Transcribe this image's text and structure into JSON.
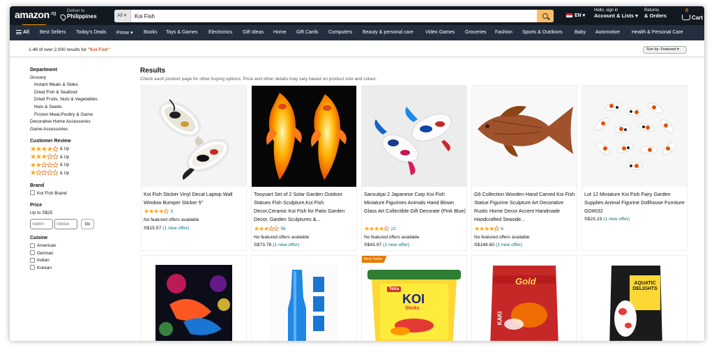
{
  "header": {
    "logo": "amazon",
    "logo_suffix": ".sg",
    "deliver_label": "Deliver to",
    "deliver_location": "Philippines",
    "search_category": "All",
    "search_value": "Koi Fish",
    "language": "EN",
    "account_hello": "Hello, sign in",
    "account_label": "Account & Lists",
    "returns_label": "Returns",
    "orders_label": "& Orders",
    "cart_count": "0",
    "cart_label": "Cart"
  },
  "nav": {
    "all_label": "All",
    "items": [
      "Best Sellers",
      "Today's Deals",
      "Prime",
      "Books",
      "Toys & Games",
      "Electronics",
      "Gift Ideas",
      "Home",
      "Gift Cards",
      "Computers",
      "Beauty & personal care",
      "Video Games",
      "Groceries",
      "Fashion",
      "Sports & Outdoors",
      "Baby",
      "Automotive",
      "Health & Personal Care"
    ]
  },
  "results_bar": {
    "count_text": "1-48 of over 2,000 results for",
    "query": "\"Koi Fish\"",
    "sort_label": "Sort by: Featured"
  },
  "sidebar": {
    "department_title": "Department",
    "department_items": [
      "Grocery",
      "Instant Meals & Sides",
      "Dried Fish & Seafood",
      "Dried Fruits, Nuts & Vegetables",
      "Nuts & Seeds",
      "Frozen Meat,Poultry & Game",
      "Decorative Home Accessories",
      "Game Accessories"
    ],
    "review_title": "Customer Review",
    "review_up": "& Up",
    "review_levels": [
      4,
      3,
      2,
      1
    ],
    "brand_title": "Brand",
    "brand_items": [
      "Koi Fish Brand"
    ],
    "price_title": "Price",
    "price_option": "Up to S$25",
    "price_min_placeholder": "S$Min",
    "price_max_placeholder": "S$Max",
    "go_label": "Go",
    "cuisine_title": "Cuisine",
    "cuisine_items": [
      "American",
      "German",
      "Indian",
      "Korean"
    ]
  },
  "main": {
    "title": "Results",
    "subtitle": "Check each product page for other buying options. Price and other details may vary based on product size and colour."
  },
  "products": [
    {
      "title": "Koi Fish Sticker Vinyl Decal Laptop Wall Window Bumper Sticker 5\"",
      "rating": 4.5,
      "reviews": "3",
      "offers": "No featured offers available",
      "price": "S$15.57",
      "new_offer": "(1 new offer)"
    },
    {
      "title": "Tooyuart Set of 2 Solar Garden Outdoor Statues Fish Sculpture,Koi Fish Decor,Ceramic Koi Fish for Patio Garden Decor, Garden Sculptures &...",
      "rating": 3.5,
      "reviews": "56",
      "offers": "No featured offers available",
      "price": "S$73.78",
      "new_offer": "(1 new offer)"
    },
    {
      "title": "Sansukjai 2 Japanese Carp Koi Fish Miniature Figurines Animals Hand Blown Glass Art Collectible Gift Decorate (Pink Blue)",
      "rating": 4.5,
      "reviews": "22",
      "offers": "No featured offers available",
      "price": "S$43.97",
      "new_offer": "(1 new offer)"
    },
    {
      "title": "G6 Collection Wooden Hand Carved Koi Fish Statue Figurine Sculpture Art Decorative Rustic Home Decor Accent Handmade Handcrafted Seaside...",
      "rating": 4.5,
      "reviews": "6",
      "offers": "No featured offers available",
      "price": "S$148.60",
      "new_offer": "(1 new offer)"
    },
    {
      "title": "Lot 12 Miniature Koi Fish Fairy Garden Supplies Animal Figurine Dollhouse Furniture GD#032",
      "price": "S$23.23",
      "new_offer": "(1 new offer)"
    }
  ],
  "row2": {
    "best_seller_label": "Best Seller",
    "tetra_brand": "Tetra",
    "tetra_name": "KOI",
    "tetra_sub": "Sticks",
    "gold_label": "Gold",
    "kaki_label": "KAKI",
    "aquatic_label": "AQUATIC DELIGHTS"
  }
}
